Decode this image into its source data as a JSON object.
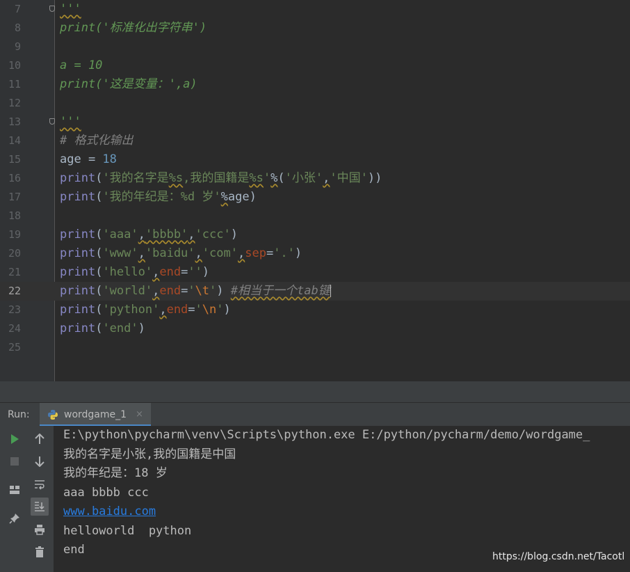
{
  "editor": {
    "current_line": "22",
    "lines": [
      {
        "n": "7"
      },
      {
        "n": "8",
        "p": [
          "print(",
          "'标准化出字符串'",
          ")"
        ]
      },
      {
        "n": "9"
      },
      {
        "n": "10",
        "p": [
          "a = 10"
        ]
      },
      {
        "n": "11",
        "p": [
          "print(",
          "'这是变量：'",
          ",a)"
        ]
      },
      {
        "n": "12"
      },
      {
        "n": "13"
      },
      {
        "n": "14",
        "p": [
          "# 格式化输出"
        ]
      },
      {
        "n": "15",
        "p": [
          "age = ",
          "18"
        ]
      },
      {
        "n": "16",
        "p": [
          "print",
          "(",
          "'我的名字是",
          "%s",
          ",我的国籍是",
          "%s",
          "'",
          "%",
          "(",
          "'小张'",
          ",",
          "'中国'",
          "))"
        ]
      },
      {
        "n": "17",
        "p": [
          "print",
          "(",
          "'我的年纪是：",
          "%d",
          " 岁'",
          "%",
          "age)"
        ]
      },
      {
        "n": "18"
      },
      {
        "n": "19",
        "p": [
          "print",
          "(",
          "'aaa'",
          ",",
          "'bbbb'",
          ",",
          "'ccc'",
          ")"
        ]
      },
      {
        "n": "20",
        "p": [
          "print",
          "(",
          "'www'",
          ",",
          "'baidu'",
          ",",
          "'com'",
          ",",
          "sep",
          "=",
          "'.'",
          ")"
        ]
      },
      {
        "n": "21",
        "p": [
          "print",
          "(",
          "'hello'",
          ",",
          "end",
          "=",
          "''",
          ")"
        ]
      },
      {
        "n": "22",
        "p": [
          "print",
          "(",
          "'world'",
          ",",
          "end",
          "=",
          "'",
          "\\t",
          "'",
          ") ",
          "#相当于一个tab键"
        ]
      },
      {
        "n": "23",
        "p": [
          "print",
          "(",
          "'python'",
          ",",
          "end",
          "=",
          "'",
          "\\n",
          "'",
          ")"
        ]
      },
      {
        "n": "24",
        "p": [
          "print",
          "(",
          "'end'",
          ")"
        ]
      },
      {
        "n": "25"
      }
    ],
    "docstring_quotes": "'''"
  },
  "run_panel": {
    "label": "Run:",
    "tab_label": "wordgame_1",
    "tab_close": "×",
    "icons": [
      "rerun-icon",
      "up-arrow-icon",
      "stop-icon",
      "down-arrow-icon",
      "layout-icon",
      "soft-wrap-icon",
      "scroll-to-end-icon",
      "pin-icon",
      "print-icon",
      "trash-icon"
    ],
    "output": [
      "E:\\python\\pycharm\\venv\\Scripts\\python.exe E:/python/pycharm/demo/wordgame_",
      "我的名字是小张,我的国籍是中国",
      "我的年纪是：18 岁",
      "aaa bbbb ccc",
      "www.baidu.com",
      "helloworld  python",
      "end"
    ]
  },
  "watermark": "https://blog.csdn.net/Tacotl",
  "colors": {
    "background": "#2b2b2b",
    "keyword": "#8888c6",
    "string": "#6a8759",
    "number": "#6897bb",
    "keyword_argument": "#aa4926",
    "escape": "#cc7832",
    "comment": "#808080",
    "link": "#287bde",
    "run_green": "#499c54"
  }
}
